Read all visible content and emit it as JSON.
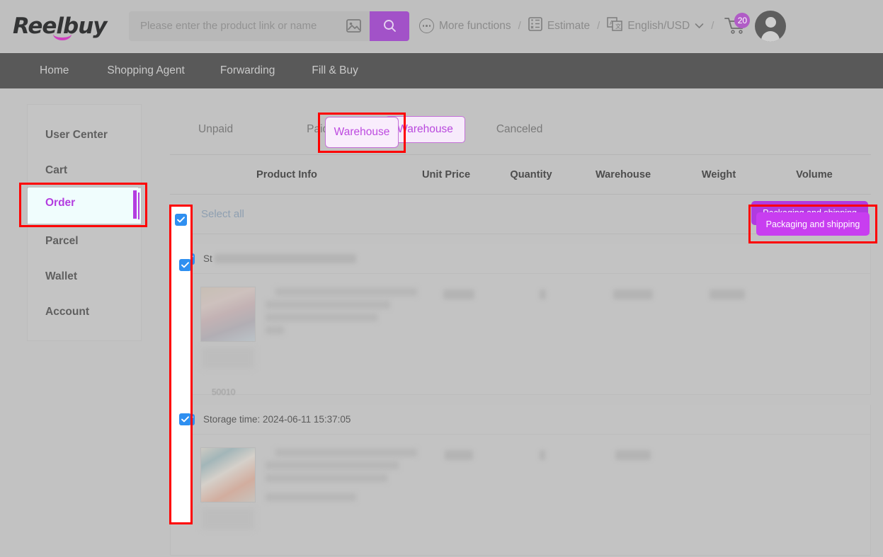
{
  "brand": {
    "name": "Reelbuy"
  },
  "search": {
    "placeholder": "Please enter the product link or name",
    "value": "",
    "image_search_icon": "image-search-icon",
    "submit_icon": "search-icon"
  },
  "header": {
    "more_functions": "More functions",
    "estimate": "Estimate",
    "language_currency": "English/USD",
    "separator": "/",
    "cart_count": "20",
    "icons": {
      "more": "more-functions-icon",
      "estimate": "estimate-icon",
      "language": "translate-icon",
      "chevron": "chevron-down-icon",
      "cart": "cart-icon",
      "avatar": "avatar-icon"
    }
  },
  "nav": {
    "items": [
      {
        "label": "Home"
      },
      {
        "label": "Shopping Agent"
      },
      {
        "label": "Forwarding"
      },
      {
        "label": "Fill & Buy"
      }
    ]
  },
  "sidebar": {
    "items": [
      {
        "label": "User Center",
        "active": false
      },
      {
        "label": "Cart",
        "active": false
      },
      {
        "label": "Order",
        "active": true
      },
      {
        "label": "Parcel",
        "active": false
      },
      {
        "label": "Wallet",
        "active": false
      },
      {
        "label": "Account",
        "active": false
      }
    ]
  },
  "tabs": [
    {
      "label": "Unpaid",
      "active": false
    },
    {
      "label": "Paid",
      "active": false
    },
    {
      "label": "Warehouse",
      "active": true
    },
    {
      "label": "Canceled",
      "active": false
    }
  ],
  "table": {
    "headers": [
      "Product Info",
      "Unit Price",
      "Quantity",
      "Warehouse",
      "Weight",
      "Volume"
    ]
  },
  "toolbar": {
    "select_all_label": "Select all",
    "select_all_checked": true,
    "packaging_button": "Packaging and shipping"
  },
  "orders": [
    {
      "checked": true,
      "title_prefix": "St",
      "title_redacted": true,
      "storage_time": "",
      "product": {
        "code": "50010",
        "thumbnail": "product-thumbnail",
        "name_redacted": true
      },
      "unit_price": "$0.72",
      "quantity": "1",
      "warehouse": "16 days",
      "weight": "0.88kg",
      "volume": ""
    },
    {
      "checked": true,
      "title_prefix": "Storage time:",
      "title_redacted": false,
      "storage_time": "Storage time: 2024-06-11 15:37:05",
      "product": {
        "code": "",
        "thumbnail": "product-thumbnail",
        "name_redacted": true
      },
      "unit_price": "",
      "quantity": "",
      "warehouse": "",
      "weight": "",
      "volume": ""
    }
  ],
  "annotations": {
    "color": "#fe0000",
    "boxes": [
      {
        "target": "sidebar-item-order"
      },
      {
        "target": "tab-warehouse"
      },
      {
        "target": "row-checkbox-column"
      },
      {
        "target": "packaging-and-shipping-button"
      }
    ]
  },
  "colors": {
    "accent_purple": "#b13ae0",
    "brand_pink": "#cf40c0",
    "nav_bg": "#595959",
    "checkbox_blue": "#2f8ff0",
    "annotation_red": "#fe0000"
  }
}
